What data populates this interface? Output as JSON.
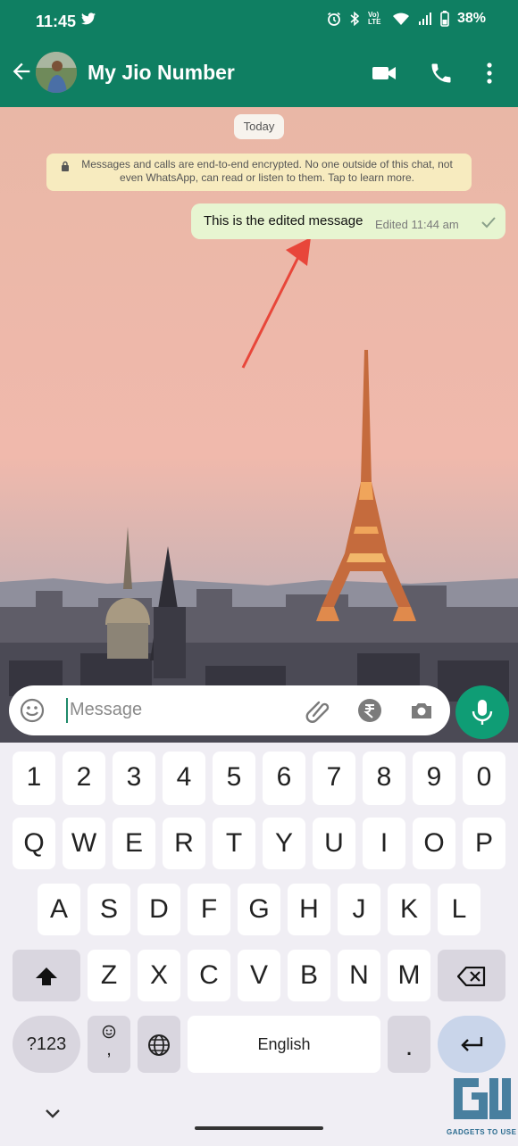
{
  "status_bar": {
    "time": "11:45",
    "battery": "38%",
    "volte_label": "Vo) LTE"
  },
  "header": {
    "contact_name": "My Jio Number",
    "icons": [
      "back-arrow-icon",
      "video-call-icon",
      "phone-icon",
      "more-options-icon"
    ]
  },
  "chat": {
    "date_chip": "Today",
    "encryption_notice": "Messages and calls are end-to-end encrypted. No one outside of this chat, not even WhatsApp, can read or listen to them. Tap to learn more.",
    "messages": [
      {
        "text": "This is the edited message",
        "meta": "Edited  11:44 am",
        "status": "sent"
      }
    ]
  },
  "composer": {
    "placeholder": "Message",
    "icons": [
      "emoji-icon",
      "attach-icon",
      "rupee-payment-icon",
      "camera-icon",
      "microphone-icon"
    ]
  },
  "keyboard": {
    "number_row": [
      "1",
      "2",
      "3",
      "4",
      "5",
      "6",
      "7",
      "8",
      "9",
      "0"
    ],
    "row1": [
      "Q",
      "W",
      "E",
      "R",
      "T",
      "Y",
      "U",
      "I",
      "O",
      "P"
    ],
    "row2": [
      "A",
      "S",
      "D",
      "F",
      "G",
      "H",
      "J",
      "K",
      "L"
    ],
    "row3": [
      "Z",
      "X",
      "C",
      "V",
      "B",
      "N",
      "M"
    ],
    "symbols_key": "?123",
    "emoji_comma_key": ",",
    "space_label": "English",
    "period_key": "."
  },
  "watermark": {
    "text": "GADGETS TO USE"
  },
  "colors": {
    "header_bg": "#0f7f62",
    "bubble_bg": "#e7f5d1",
    "notice_bg": "#f7ebbf",
    "mic_bg": "#0f9d75",
    "keyboard_bg": "#f0eef4",
    "annotation_arrow": "#e8463a"
  }
}
